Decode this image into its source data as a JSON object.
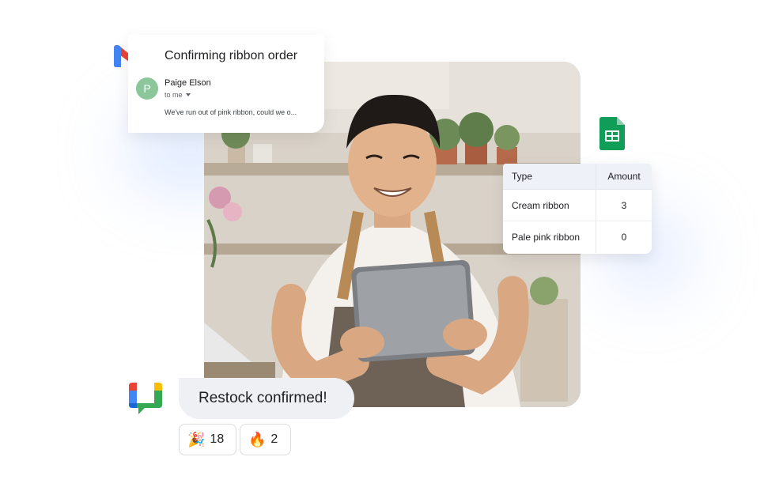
{
  "email": {
    "app_icon": "gmail-icon",
    "subject": "Confirming ribbon order",
    "avatar_letter": "P",
    "sender": "Paige Elson",
    "recipient": "to me",
    "snippet": "We've run out of pink ribbon, could we o..."
  },
  "sheet": {
    "app_icon": "sheets-icon",
    "headers": {
      "type": "Type",
      "amount": "Amount"
    },
    "rows": [
      {
        "type": "Cream ribbon",
        "amount": "3"
      },
      {
        "type": "Pale pink ribbon",
        "amount": "0"
      }
    ]
  },
  "chat": {
    "app_icon": "google-chat-icon",
    "message": "Restock confirmed!",
    "reactions": [
      {
        "emoji": "🎉",
        "count": "18"
      },
      {
        "emoji": "🔥",
        "count": "2"
      }
    ]
  },
  "photo": {
    "subject": "shop-owner-with-tablet-photo"
  },
  "colors": {
    "gmail_red": "#ea4335",
    "gmail_blue": "#4285f4",
    "gmail_green": "#34a853",
    "gmail_yellow": "#fbbc04",
    "sheets_green": "#0f9d58",
    "avatar_green": "#8bc79a",
    "chat_bubble": "#eef0f4"
  }
}
